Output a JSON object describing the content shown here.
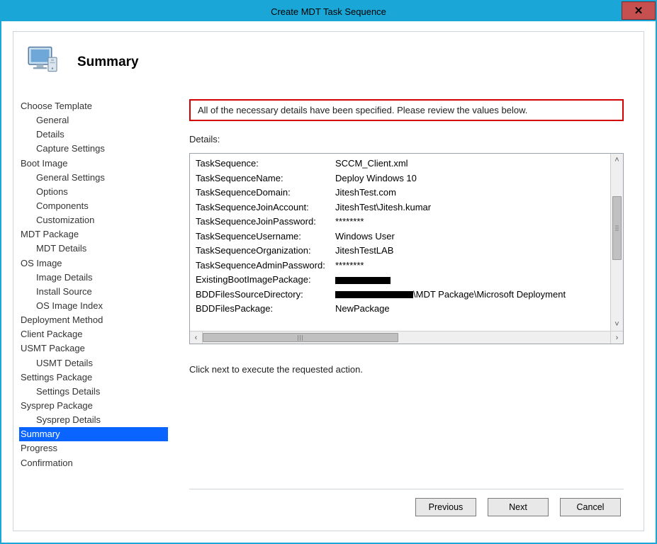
{
  "window": {
    "title": "Create MDT Task Sequence",
    "close_label": "✕"
  },
  "header": {
    "heading": "Summary"
  },
  "nav": [
    {
      "label": "Choose Template",
      "type": "top"
    },
    {
      "label": "General",
      "type": "sub"
    },
    {
      "label": "Details",
      "type": "sub"
    },
    {
      "label": "Capture Settings",
      "type": "sub"
    },
    {
      "label": "Boot Image",
      "type": "top"
    },
    {
      "label": "General Settings",
      "type": "sub"
    },
    {
      "label": "Options",
      "type": "sub"
    },
    {
      "label": "Components",
      "type": "sub"
    },
    {
      "label": "Customization",
      "type": "sub"
    },
    {
      "label": "MDT Package",
      "type": "top"
    },
    {
      "label": "MDT Details",
      "type": "sub"
    },
    {
      "label": "OS Image",
      "type": "top"
    },
    {
      "label": "Image Details",
      "type": "sub"
    },
    {
      "label": "Install Source",
      "type": "sub"
    },
    {
      "label": "OS Image Index",
      "type": "sub"
    },
    {
      "label": "Deployment Method",
      "type": "top"
    },
    {
      "label": "Client Package",
      "type": "top"
    },
    {
      "label": "USMT Package",
      "type": "top"
    },
    {
      "label": "USMT Details",
      "type": "sub"
    },
    {
      "label": "Settings Package",
      "type": "top"
    },
    {
      "label": "Settings Details",
      "type": "sub"
    },
    {
      "label": "Sysprep Package",
      "type": "top"
    },
    {
      "label": "Sysprep Details",
      "type": "sub"
    },
    {
      "label": "Summary",
      "type": "top",
      "selected": true
    },
    {
      "label": "Progress",
      "type": "top"
    },
    {
      "label": "Confirmation",
      "type": "top"
    }
  ],
  "content": {
    "instruction": "All of the necessary details have been specified.  Please review the values below.",
    "details_label": "Details:",
    "click_next": "Click next to execute the requested action.",
    "rows": [
      {
        "key": "TaskSequence:",
        "value": "SCCM_Client.xml"
      },
      {
        "key": "TaskSequenceName:",
        "value": "Deploy Windows 10"
      },
      {
        "key": "TaskSequenceDomain:",
        "value": "JiteshTest.com"
      },
      {
        "key": "TaskSequenceJoinAccount:",
        "value": "JiteshTest\\Jitesh.kumar"
      },
      {
        "key": "TaskSequenceJoinPassword:",
        "value": "********"
      },
      {
        "key": "TaskSequenceUsername:",
        "value": "Windows User"
      },
      {
        "key": "TaskSequenceOrganization:",
        "value": "JiteshTestLAB"
      },
      {
        "key": "TaskSequenceAdminPassword:",
        "value": "********"
      },
      {
        "key": "ExistingBootImagePackage:",
        "value": "",
        "redacted": 78
      },
      {
        "key": "BDDFilesSourceDirectory:",
        "value": "\\MDT Package\\Microsoft Deployment",
        "redacted": 110
      },
      {
        "key": "BDDFilesPackage:",
        "value": "NewPackage"
      }
    ]
  },
  "buttons": {
    "previous": "Previous",
    "next": "Next",
    "cancel": "Cancel"
  }
}
